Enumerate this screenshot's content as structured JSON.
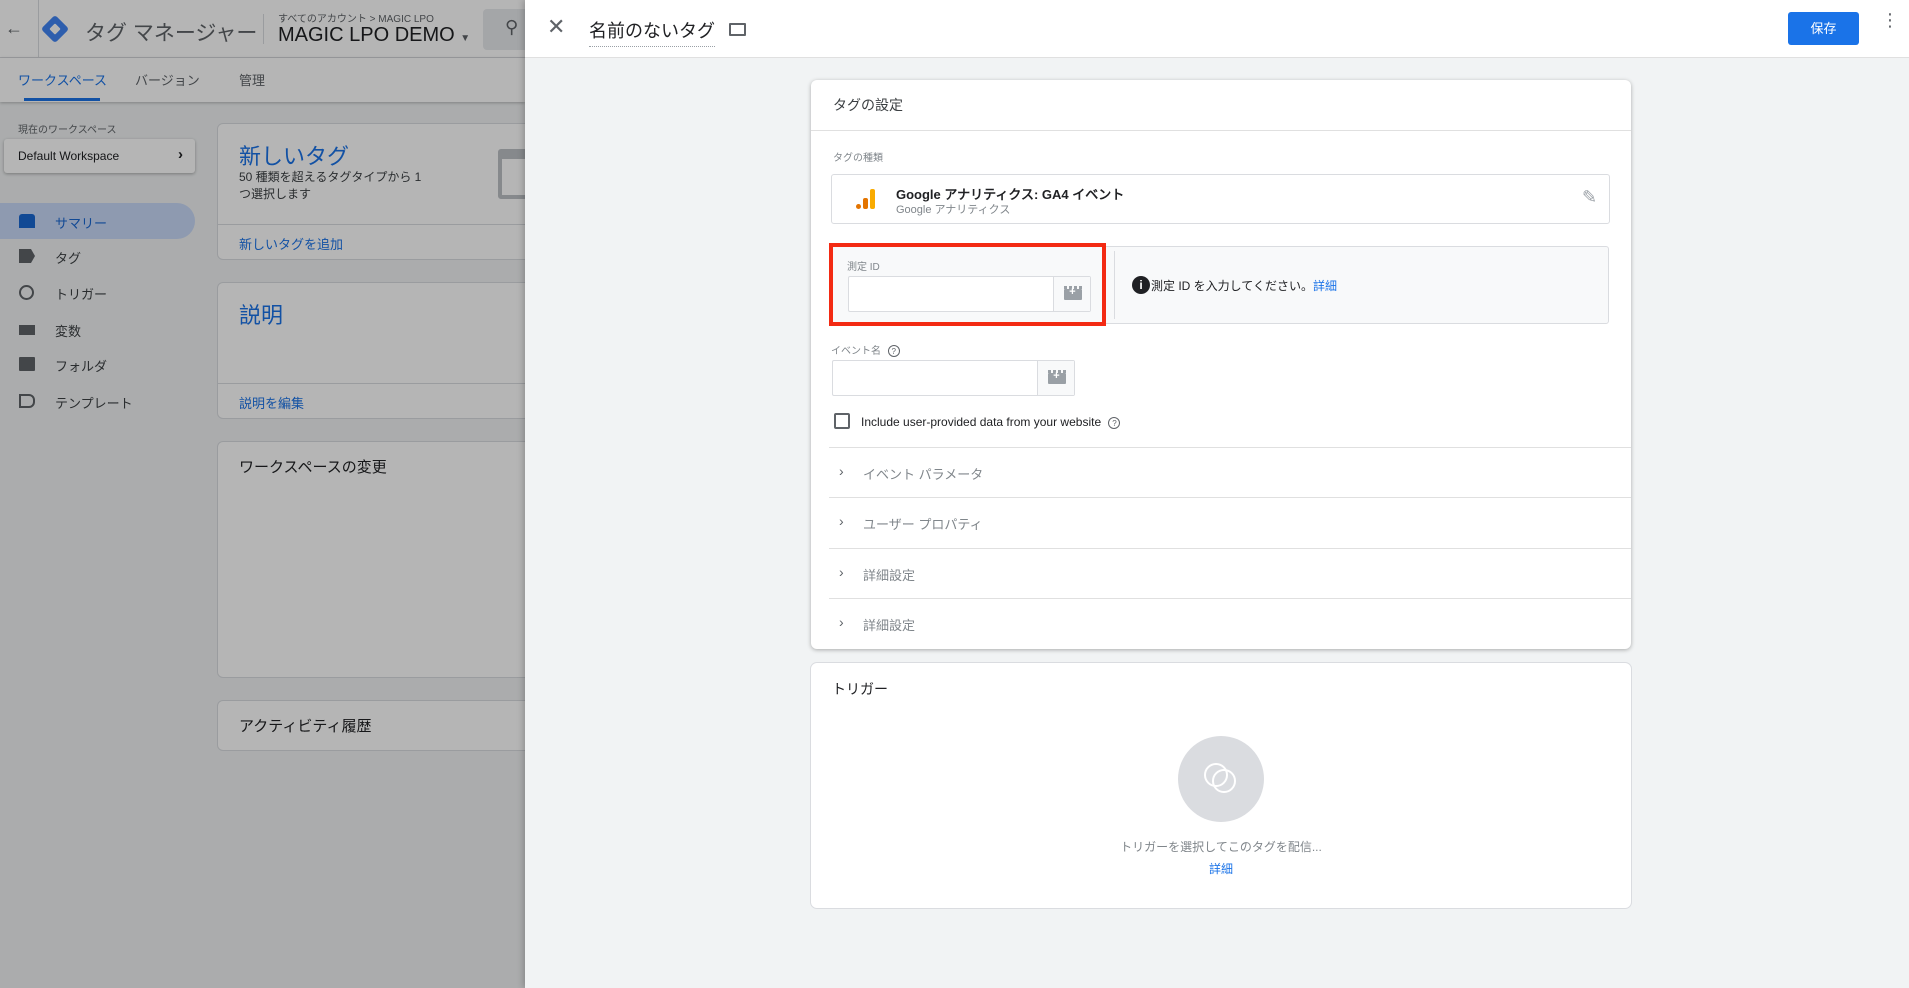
{
  "app": {
    "title": "タグ マネージャー",
    "breadcrumb": "すべてのアカウント > MAGIC LPO",
    "container": "MAGIC LPO DEMO",
    "tabs": [
      "ワークスペース",
      "バージョン",
      "管理"
    ],
    "workspace_label": "現在のワークスペース",
    "workspace_name": "Default Workspace",
    "nav": [
      {
        "label": "サマリー",
        "icon": "summary-icon"
      },
      {
        "label": "タグ",
        "icon": "tag-icon"
      },
      {
        "label": "トリガー",
        "icon": "trigger-icon"
      },
      {
        "label": "変数",
        "icon": "variable-icon"
      },
      {
        "label": "フォルダ",
        "icon": "folder-icon"
      },
      {
        "label": "テンプレート",
        "icon": "template-icon"
      }
    ],
    "cards": {
      "new_tag_title": "新しいタグ",
      "new_tag_desc1": "50 種類を超えるタグタイプから 1",
      "new_tag_desc2": "つ選択します",
      "new_tag_link": "新しいタグを追加",
      "desc_title": "説明",
      "desc_link": "説明を編集",
      "changes_title": "ワークスペースの変更",
      "activity_title": "アクティビティ履歴"
    }
  },
  "panel": {
    "title": "名前のないタグ",
    "save_label": "保存",
    "config": {
      "heading": "タグの設定",
      "type_label": "タグの種類",
      "type_name": "Google アナリティクス: GA4 イベント",
      "type_sub": "Google アナリティクス",
      "measurement_label": "測定 ID",
      "measurement_value": "",
      "info_text": "測定 ID を入力してください。",
      "info_link": "詳細",
      "event_label": "イベント名",
      "event_value": "",
      "checkbox_label": "Include user-provided data from your website",
      "sections": [
        "イベント パラメータ",
        "ユーザー プロパティ",
        "詳細設定",
        "詳細設定"
      ]
    },
    "trigger": {
      "heading": "トリガー",
      "empty_text": "トリガーを選択してこのタグを配信...",
      "link": "詳細"
    },
    "colors": {
      "accent": "#1a73e8",
      "highlight": "#f32a13"
    }
  }
}
